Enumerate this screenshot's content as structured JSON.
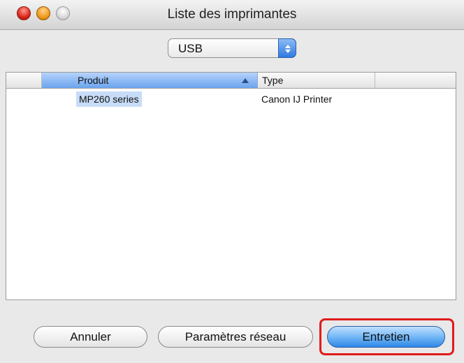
{
  "window": {
    "title": "Liste des imprimantes"
  },
  "connection": {
    "selected": "USB",
    "stepper_icon": "up-down-arrows-icon"
  },
  "table": {
    "columns": [
      {
        "label": ""
      },
      {
        "label": "Produit",
        "sort": "ascending"
      },
      {
        "label": "Type"
      },
      {
        "label": ""
      }
    ],
    "rows": [
      {
        "product": "MP260 series",
        "type": "Canon IJ Printer",
        "selected": true
      }
    ]
  },
  "buttons": {
    "cancel": "Annuler",
    "network": "Paramètres réseau",
    "maintenance": "Entretien"
  },
  "colors": {
    "highlight": "#e11b1b",
    "default_button": "#6db3f5",
    "selection": "#c7dcf7"
  }
}
